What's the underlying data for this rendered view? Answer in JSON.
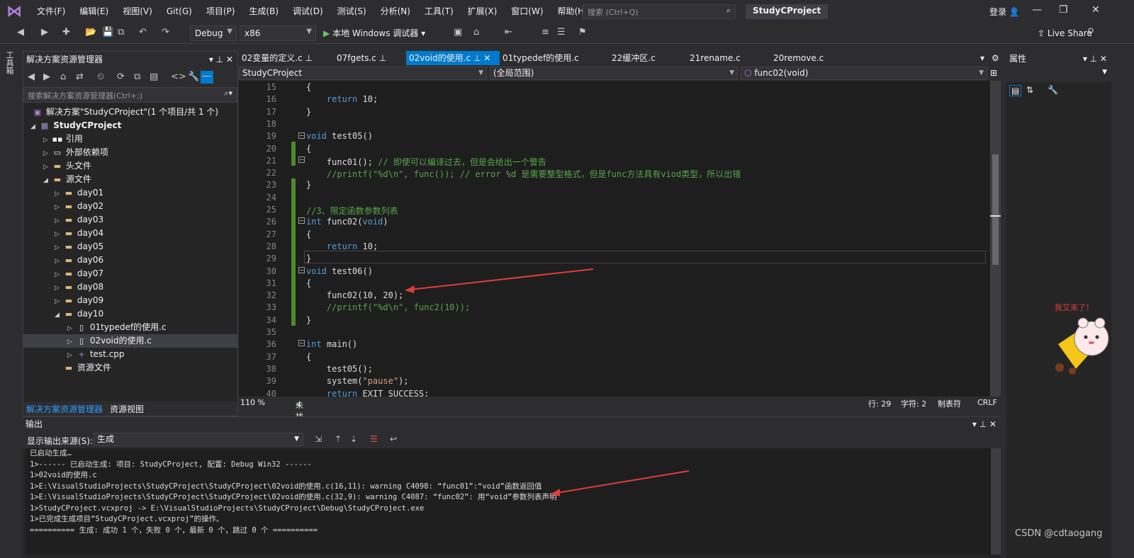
{
  "menu": [
    "文件(F)",
    "编辑(E)",
    "视图(V)",
    "Git(G)",
    "项目(P)",
    "生成(B)",
    "调试(D)",
    "测试(S)",
    "分析(N)",
    "工具(T)",
    "扩展(X)",
    "窗口(W)",
    "帮助(H)"
  ],
  "search": {
    "placeholder": "搜索 (Ctrl+Q)"
  },
  "project_title": "StudyCProject",
  "login": "登录",
  "toolbar": {
    "config": "Debug",
    "platform": "x86",
    "run": "本地 Windows 调试器",
    "live_share": "Live Share"
  },
  "toolbox_label": "工具箱",
  "solution_explorer": {
    "title": "解决方案资源管理器",
    "search": "搜索解决方案资源管理器(Ctrl+;)",
    "solution": "解决方案\"StudyCProject\"(1 个项目/共 1 个)",
    "project": "StudyCProject",
    "nodes": [
      "引用",
      "外部依赖项",
      "头文件",
      "源文件",
      "day01",
      "day02",
      "day03",
      "day04",
      "day05",
      "day06",
      "day07",
      "day08",
      "day09",
      "day10",
      "01typedef的使用.c",
      "02void的使用.c",
      "test.cpp",
      "资源文件"
    ],
    "bottom_tabs": [
      "解决方案资源管理器",
      "资源视图"
    ]
  },
  "tabs": [
    "02变量的定义.c",
    "07fgets.c",
    "02void的使用.c",
    "01typedef的使用.c",
    "22缓冲区.c",
    "21rename.c",
    "20remove.c"
  ],
  "nav": {
    "project": "StudyCProject",
    "scope": "(全局范围)",
    "func": "func02(void)"
  },
  "code_lines": [
    {
      "n": "15",
      "t": "{"
    },
    {
      "n": "16",
      "t": "    return 10;"
    },
    {
      "n": "17",
      "t": "}"
    },
    {
      "n": "18",
      "t": ""
    },
    {
      "n": "19",
      "t": "void test05()"
    },
    {
      "n": "20",
      "t": "{"
    },
    {
      "n": "21",
      "t": "    func01(); // 即使可以编译过去，但是会给出一个警告"
    },
    {
      "n": "22",
      "t": "    //printf(\"%d\\n\", func()); // error %d 是需要整型格式，但是func方法具有viod类型，所以出错"
    },
    {
      "n": "23",
      "t": "}"
    },
    {
      "n": "24",
      "t": ""
    },
    {
      "n": "25",
      "t": "//3、限定函数参数列表"
    },
    {
      "n": "26",
      "t": "int func02(void)"
    },
    {
      "n": "27",
      "t": "{"
    },
    {
      "n": "28",
      "t": "    return 10;"
    },
    {
      "n": "29",
      "t": "}"
    },
    {
      "n": "30",
      "t": "void test06()"
    },
    {
      "n": "31",
      "t": "{"
    },
    {
      "n": "32",
      "t": "    func02(10, 20);"
    },
    {
      "n": "33",
      "t": "    //printf(\"%d\\n\", func2(10));"
    },
    {
      "n": "34",
      "t": "}"
    },
    {
      "n": "35",
      "t": ""
    },
    {
      "n": "36",
      "t": "int main()"
    },
    {
      "n": "37",
      "t": "{"
    },
    {
      "n": "38",
      "t": "    test05();"
    },
    {
      "n": "39",
      "t": "    system(\"pause\");"
    },
    {
      "n": "40",
      "t": "    return EXIT_SUCCESS;"
    }
  ],
  "status": {
    "zoom": "110 %",
    "issues": "未找到相关问题",
    "line": "行: 29",
    "col": "字符: 2",
    "tab": "制表符",
    "eol": "CRLF"
  },
  "properties": {
    "title": "属性"
  },
  "output": {
    "title": "输出",
    "source_label": "显示输出来源(S):",
    "source": "生成",
    "lines": [
      "已启动生成…",
      "1>------ 已启动生成: 项目: StudyCProject, 配置: Debug Win32 ------",
      "1>02void的使用.c",
      "1>E:\\VisualStudioProjects\\StudyCProject\\StudyCProject\\02void的使用.c(16,11): warning C4098: “func01”:“void”函数返回值",
      "1>E:\\VisualStudioProjects\\StudyCProject\\StudyCProject\\02void的使用.c(32,9): warning C4087: “func02”: 用“void”参数列表声明",
      "1>StudyCProject.vcxproj -> E:\\VisualStudioProjects\\StudyCProject\\Debug\\StudyCProject.exe",
      "1>已完成生成项目“StudyCProject.vcxproj”的操作。",
      "========== 生成: 成功 1 个，失败 0 个，最新 0 个，跳过 0 个 =========="
    ]
  },
  "watermark": "CSDN @cdtaogang",
  "mascot_text": "我又来了！"
}
